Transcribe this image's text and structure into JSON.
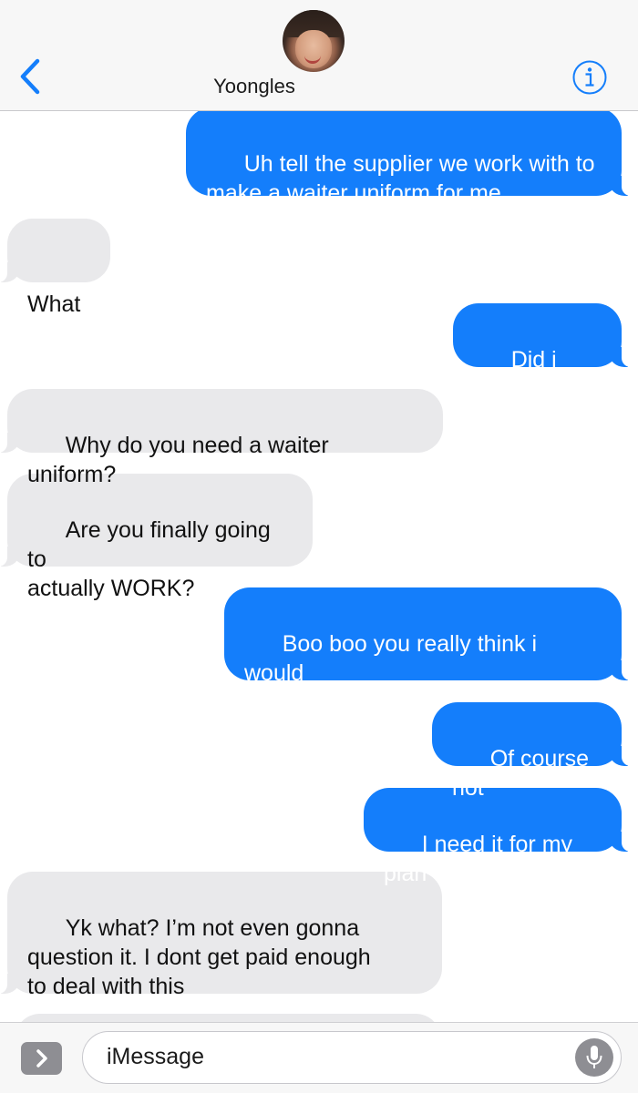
{
  "header": {
    "contact_name": "Yoongles"
  },
  "messages": [
    {
      "side": "sent",
      "text": "Uh tell the supplier we work with to\nmake a waiter uniform for me"
    },
    {
      "side": "recv",
      "text": "What"
    },
    {
      "side": "sent",
      "text": "Did i stutter"
    },
    {
      "side": "recv",
      "text": "Why do you need a waiter uniform?"
    },
    {
      "side": "recv",
      "text": "Are you finally going to\nactually WORK?"
    },
    {
      "side": "sent",
      "text": "Boo boo you really think i would\ndo that"
    },
    {
      "side": "sent",
      "text": "Of course not"
    },
    {
      "side": "sent",
      "text": "I need it for my plan"
    },
    {
      "side": "recv",
      "text": "Yk what? I’m not even gonna\nquestion it. I dont get paid enough\nto deal with this"
    }
  ],
  "composer": {
    "placeholder": "iMessage"
  },
  "colors": {
    "sent_bubble": "#147efb",
    "received_bubble": "#e9e9eb",
    "accent": "#147efb"
  },
  "icons": {
    "back": "chevron-left-icon",
    "info": "info-icon",
    "apps": "chevron-right-icon",
    "mic": "microphone-icon"
  }
}
